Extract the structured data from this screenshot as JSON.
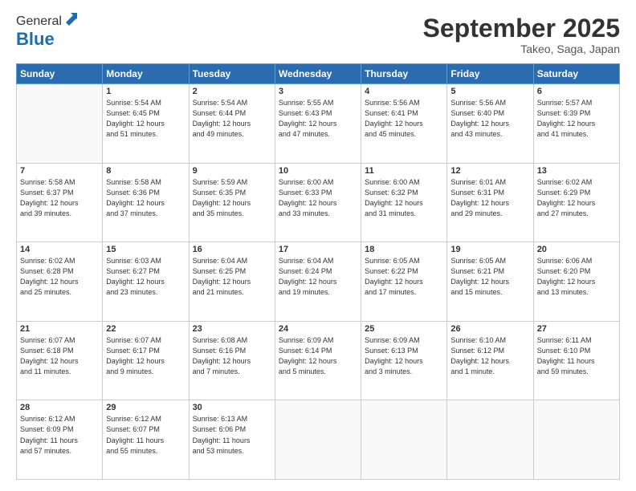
{
  "header": {
    "logo_general": "General",
    "logo_blue": "Blue",
    "month_title": "September 2025",
    "location": "Takeo, Saga, Japan"
  },
  "days_of_week": [
    "Sunday",
    "Monday",
    "Tuesday",
    "Wednesday",
    "Thursday",
    "Friday",
    "Saturday"
  ],
  "weeks": [
    [
      {
        "day": "",
        "info": ""
      },
      {
        "day": "1",
        "info": "Sunrise: 5:54 AM\nSunset: 6:45 PM\nDaylight: 12 hours\nand 51 minutes."
      },
      {
        "day": "2",
        "info": "Sunrise: 5:54 AM\nSunset: 6:44 PM\nDaylight: 12 hours\nand 49 minutes."
      },
      {
        "day": "3",
        "info": "Sunrise: 5:55 AM\nSunset: 6:43 PM\nDaylight: 12 hours\nand 47 minutes."
      },
      {
        "day": "4",
        "info": "Sunrise: 5:56 AM\nSunset: 6:41 PM\nDaylight: 12 hours\nand 45 minutes."
      },
      {
        "day": "5",
        "info": "Sunrise: 5:56 AM\nSunset: 6:40 PM\nDaylight: 12 hours\nand 43 minutes."
      },
      {
        "day": "6",
        "info": "Sunrise: 5:57 AM\nSunset: 6:39 PM\nDaylight: 12 hours\nand 41 minutes."
      }
    ],
    [
      {
        "day": "7",
        "info": "Sunrise: 5:58 AM\nSunset: 6:37 PM\nDaylight: 12 hours\nand 39 minutes."
      },
      {
        "day": "8",
        "info": "Sunrise: 5:58 AM\nSunset: 6:36 PM\nDaylight: 12 hours\nand 37 minutes."
      },
      {
        "day": "9",
        "info": "Sunrise: 5:59 AM\nSunset: 6:35 PM\nDaylight: 12 hours\nand 35 minutes."
      },
      {
        "day": "10",
        "info": "Sunrise: 6:00 AM\nSunset: 6:33 PM\nDaylight: 12 hours\nand 33 minutes."
      },
      {
        "day": "11",
        "info": "Sunrise: 6:00 AM\nSunset: 6:32 PM\nDaylight: 12 hours\nand 31 minutes."
      },
      {
        "day": "12",
        "info": "Sunrise: 6:01 AM\nSunset: 6:31 PM\nDaylight: 12 hours\nand 29 minutes."
      },
      {
        "day": "13",
        "info": "Sunrise: 6:02 AM\nSunset: 6:29 PM\nDaylight: 12 hours\nand 27 minutes."
      }
    ],
    [
      {
        "day": "14",
        "info": "Sunrise: 6:02 AM\nSunset: 6:28 PM\nDaylight: 12 hours\nand 25 minutes."
      },
      {
        "day": "15",
        "info": "Sunrise: 6:03 AM\nSunset: 6:27 PM\nDaylight: 12 hours\nand 23 minutes."
      },
      {
        "day": "16",
        "info": "Sunrise: 6:04 AM\nSunset: 6:25 PM\nDaylight: 12 hours\nand 21 minutes."
      },
      {
        "day": "17",
        "info": "Sunrise: 6:04 AM\nSunset: 6:24 PM\nDaylight: 12 hours\nand 19 minutes."
      },
      {
        "day": "18",
        "info": "Sunrise: 6:05 AM\nSunset: 6:22 PM\nDaylight: 12 hours\nand 17 minutes."
      },
      {
        "day": "19",
        "info": "Sunrise: 6:05 AM\nSunset: 6:21 PM\nDaylight: 12 hours\nand 15 minutes."
      },
      {
        "day": "20",
        "info": "Sunrise: 6:06 AM\nSunset: 6:20 PM\nDaylight: 12 hours\nand 13 minutes."
      }
    ],
    [
      {
        "day": "21",
        "info": "Sunrise: 6:07 AM\nSunset: 6:18 PM\nDaylight: 12 hours\nand 11 minutes."
      },
      {
        "day": "22",
        "info": "Sunrise: 6:07 AM\nSunset: 6:17 PM\nDaylight: 12 hours\nand 9 minutes."
      },
      {
        "day": "23",
        "info": "Sunrise: 6:08 AM\nSunset: 6:16 PM\nDaylight: 12 hours\nand 7 minutes."
      },
      {
        "day": "24",
        "info": "Sunrise: 6:09 AM\nSunset: 6:14 PM\nDaylight: 12 hours\nand 5 minutes."
      },
      {
        "day": "25",
        "info": "Sunrise: 6:09 AM\nSunset: 6:13 PM\nDaylight: 12 hours\nand 3 minutes."
      },
      {
        "day": "26",
        "info": "Sunrise: 6:10 AM\nSunset: 6:12 PM\nDaylight: 12 hours\nand 1 minute."
      },
      {
        "day": "27",
        "info": "Sunrise: 6:11 AM\nSunset: 6:10 PM\nDaylight: 11 hours\nand 59 minutes."
      }
    ],
    [
      {
        "day": "28",
        "info": "Sunrise: 6:12 AM\nSunset: 6:09 PM\nDaylight: 11 hours\nand 57 minutes."
      },
      {
        "day": "29",
        "info": "Sunrise: 6:12 AM\nSunset: 6:07 PM\nDaylight: 11 hours\nand 55 minutes."
      },
      {
        "day": "30",
        "info": "Sunrise: 6:13 AM\nSunset: 6:06 PM\nDaylight: 11 hours\nand 53 minutes."
      },
      {
        "day": "",
        "info": ""
      },
      {
        "day": "",
        "info": ""
      },
      {
        "day": "",
        "info": ""
      },
      {
        "day": "",
        "info": ""
      }
    ]
  ]
}
